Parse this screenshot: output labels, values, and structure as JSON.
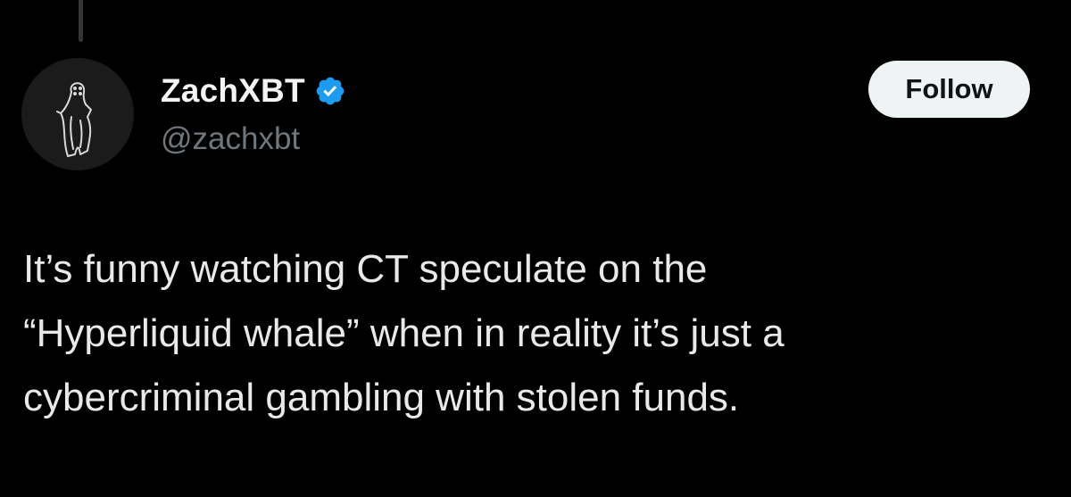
{
  "author": {
    "display_name": "ZachXBT",
    "handle": "@zachxbt",
    "verified": true,
    "verified_color": "#1d9bf0",
    "avatar_icon": "ghost-penguin-avatar"
  },
  "actions": {
    "follow_label": "Follow"
  },
  "tweet": {
    "lines": [
      "It’s funny watching CT speculate on the",
      "“Hyperliquid whale” when in reality it’s just a",
      "cybercriminal gambling with stolen funds."
    ]
  },
  "colors": {
    "background": "#000000",
    "text_primary": "#e7e9ea",
    "text_secondary": "#71767b",
    "button_bg": "#eff3f4"
  }
}
